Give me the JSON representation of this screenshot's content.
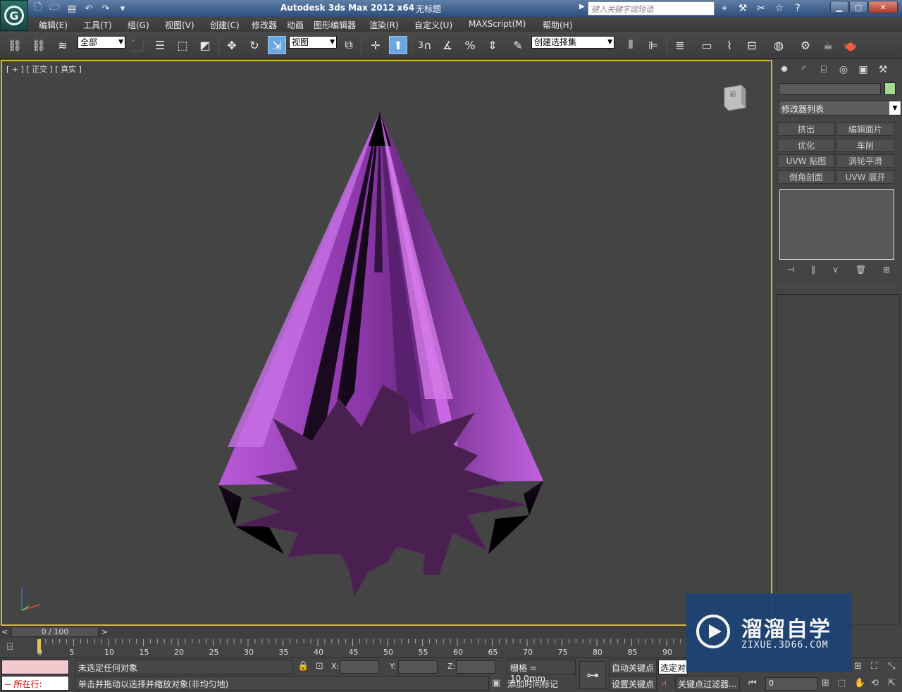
{
  "window": {
    "app_title": "Autodesk 3ds Max  2012 x64",
    "doc_title": "无标题",
    "search_placeholder": "键入关键字或短语"
  },
  "menu": [
    "编辑(E)",
    "工具(T)",
    "组(G)",
    "视图(V)",
    "创建(C)",
    "修改器",
    "动画",
    "图形编辑器",
    "渲染(R)",
    "自定义(U)",
    "MAXScript(M)",
    "帮助(H)"
  ],
  "toolbar": {
    "selection_filter": "全部",
    "ref_coord": "视图",
    "snap_label": "3",
    "named_selection": "创建选择集"
  },
  "viewport": {
    "label": "[ + ] [ 正交 ] [ 真实 ]",
    "cube_label": "前",
    "object_color": "#a64ac9",
    "shade_color": "#4a2050"
  },
  "command_panel": {
    "modifier_list": "修改器列表",
    "object_color": "#a3d98f",
    "buttons": [
      "挤出",
      "编辑面片",
      "优化",
      "车削",
      "UVW 贴图",
      "涡轮平滑",
      "倒角剖面",
      "UVW 展开"
    ]
  },
  "timeline": {
    "frame_display": "0 / 100",
    "ticks": [
      "0",
      "5",
      "10",
      "15",
      "20",
      "25",
      "30",
      "35",
      "40",
      "45",
      "50",
      "55",
      "60",
      "65",
      "70",
      "75",
      "80",
      "85",
      "90"
    ]
  },
  "status": {
    "listener_prefix": "-- 所在行:",
    "selection": "未选定任何对象",
    "prompt": "单击并拖动以选择并缩放对象(非均匀地)",
    "x_label": "X:",
    "y_label": "Y:",
    "z_label": "Z:",
    "grid": "栅格 = 10.0mm",
    "add_time_tag": "添加时间标记",
    "auto_key": "自动关键点",
    "set_key": "设置关键点",
    "selected_dropdown": "选定对象",
    "key_filters": "关键点过滤器...",
    "frame_value": "0"
  },
  "watermark": {
    "title": "溜溜自学",
    "subtitle": "ZIXUE.3D66.COM"
  }
}
